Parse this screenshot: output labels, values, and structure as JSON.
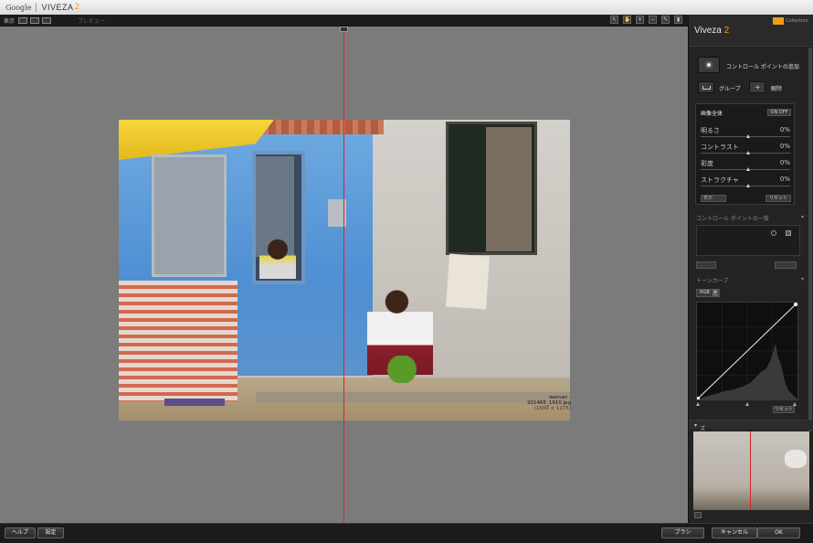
{
  "titlebar": {
    "google": "Google",
    "app": "VIVEZA",
    "version": "2"
  },
  "toolbar": {
    "view_label": "表示",
    "preview_label": "プレビュー"
  },
  "image": {
    "filename": "woman - 201465_1910.jpg",
    "dimensions": "(1500 × 1175)"
  },
  "panel": {
    "title": "Viveza",
    "title_version": "2",
    "brand_small": "Collection",
    "add_control_point": "コントロール ポイントの追加",
    "group": "グループ",
    "ungroup": "解除",
    "global": {
      "title": "画像全体",
      "toggle": "ON  OFF",
      "sliders": [
        {
          "label": "明るさ",
          "value": "0%"
        },
        {
          "label": "コントラスト",
          "value": "0%"
        },
        {
          "label": "彩度",
          "value": "0%"
        },
        {
          "label": "ストラクチャ",
          "value": "0%"
        }
      ],
      "dropdown": "表示",
      "reset": "リセット"
    },
    "cp_list_title": "コントロール ポイントの一覧",
    "tone_curve_title": "トーンカーブ",
    "tone_channel": "RGB",
    "curve_reset": "リセット",
    "zoom_title": "ズーム"
  },
  "bottom": {
    "help": "ヘルプ",
    "settings": "設定",
    "brush": "ブラシ",
    "cancel": "キャンセル",
    "ok": "OK"
  },
  "colors": {
    "accent": "#e8a117",
    "split_line": "#d62828"
  }
}
